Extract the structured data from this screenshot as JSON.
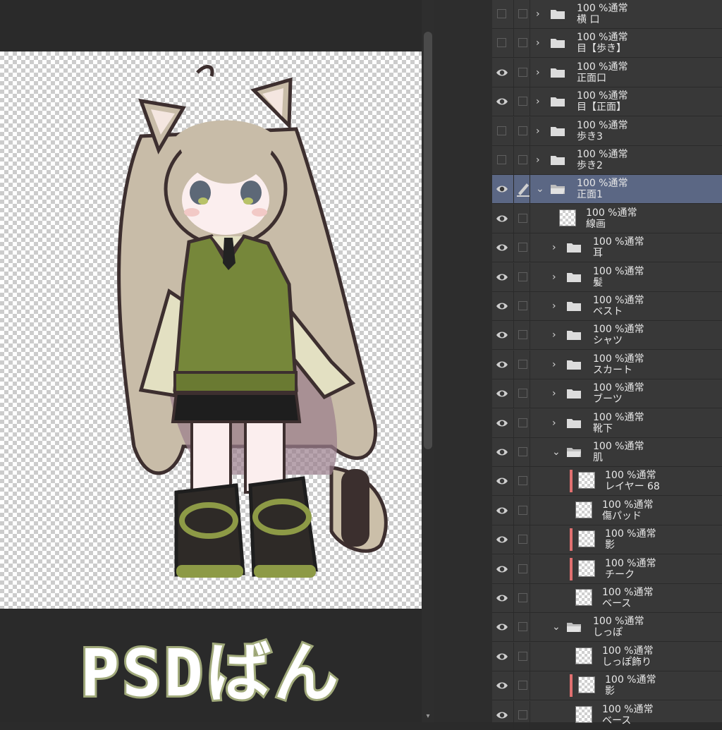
{
  "canvas": {
    "caption": "PSDばん",
    "caption_colors": {
      "fill": "#ffffff",
      "outline": "#a0a97a"
    }
  },
  "layers": [
    {
      "mode": "100 %通常",
      "name": "横 口",
      "type": "folder",
      "visible": false,
      "indent": 0,
      "expanded": false
    },
    {
      "mode": "100 %通常",
      "name": "目【歩き】",
      "type": "folder",
      "visible": false,
      "indent": 0,
      "expanded": false
    },
    {
      "mode": "100 %通常",
      "name": "正面口",
      "type": "folder",
      "visible": true,
      "indent": 0,
      "expanded": false
    },
    {
      "mode": "100 %通常",
      "name": "目【正面】",
      "type": "folder",
      "visible": true,
      "indent": 0,
      "expanded": false
    },
    {
      "mode": "100 %通常",
      "name": "歩き3",
      "type": "folder",
      "visible": false,
      "indent": 0,
      "expanded": false
    },
    {
      "mode": "100 %通常",
      "name": "歩き2",
      "type": "folder",
      "visible": false,
      "indent": 0,
      "expanded": false
    },
    {
      "mode": "100 %通常",
      "name": "正面1",
      "type": "folder",
      "visible": true,
      "indent": 0,
      "expanded": true,
      "selected": true,
      "editing": true
    },
    {
      "mode": "100 %通常",
      "name": "線画",
      "type": "layer",
      "visible": true,
      "indent": 1
    },
    {
      "mode": "100 %通常",
      "name": "耳",
      "type": "folder",
      "visible": true,
      "indent": 1,
      "expanded": false
    },
    {
      "mode": "100 %通常",
      "name": "髪",
      "type": "folder",
      "visible": true,
      "indent": 1,
      "expanded": false
    },
    {
      "mode": "100 %通常",
      "name": "ベスト",
      "type": "folder",
      "visible": true,
      "indent": 1,
      "expanded": false
    },
    {
      "mode": "100 %通常",
      "name": "シャツ",
      "type": "folder",
      "visible": true,
      "indent": 1,
      "expanded": false
    },
    {
      "mode": "100 %通常",
      "name": "スカート",
      "type": "folder",
      "visible": true,
      "indent": 1,
      "expanded": false
    },
    {
      "mode": "100 %通常",
      "name": "ブーツ",
      "type": "folder",
      "visible": true,
      "indent": 1,
      "expanded": false
    },
    {
      "mode": "100 %通常",
      "name": "靴下",
      "type": "folder",
      "visible": true,
      "indent": 1,
      "expanded": false
    },
    {
      "mode": "100 %通常",
      "name": "肌",
      "type": "folder",
      "visible": true,
      "indent": 1,
      "expanded": true
    },
    {
      "mode": "100 %通常",
      "name": "レイヤー 68",
      "type": "layer",
      "visible": true,
      "indent": 2,
      "clipped": true
    },
    {
      "mode": "100 %通常",
      "name": "傷パッド",
      "type": "layer",
      "visible": true,
      "indent": 2
    },
    {
      "mode": "100 %通常",
      "name": "影",
      "type": "layer",
      "visible": true,
      "indent": 2,
      "clipped": true
    },
    {
      "mode": "100 %通常",
      "name": "チーク",
      "type": "layer",
      "visible": true,
      "indent": 2,
      "clipped": true
    },
    {
      "mode": "100 %通常",
      "name": "ベース",
      "type": "layer",
      "visible": true,
      "indent": 2
    },
    {
      "mode": "100 %通常",
      "name": "しっぽ",
      "type": "folder",
      "visible": true,
      "indent": 1,
      "expanded": true
    },
    {
      "mode": "100 %通常",
      "name": "しっぽ飾り",
      "type": "layer",
      "visible": true,
      "indent": 2
    },
    {
      "mode": "100 %通常",
      "name": "影",
      "type": "layer",
      "visible": true,
      "indent": 2,
      "clipped": true
    },
    {
      "mode": "100 %通常",
      "name": "ベース",
      "type": "layer",
      "visible": true,
      "indent": 2
    }
  ],
  "colors": {
    "selected_row": "#5b6784",
    "clip_marker": "#e07070",
    "panel_bg": "#383838"
  }
}
